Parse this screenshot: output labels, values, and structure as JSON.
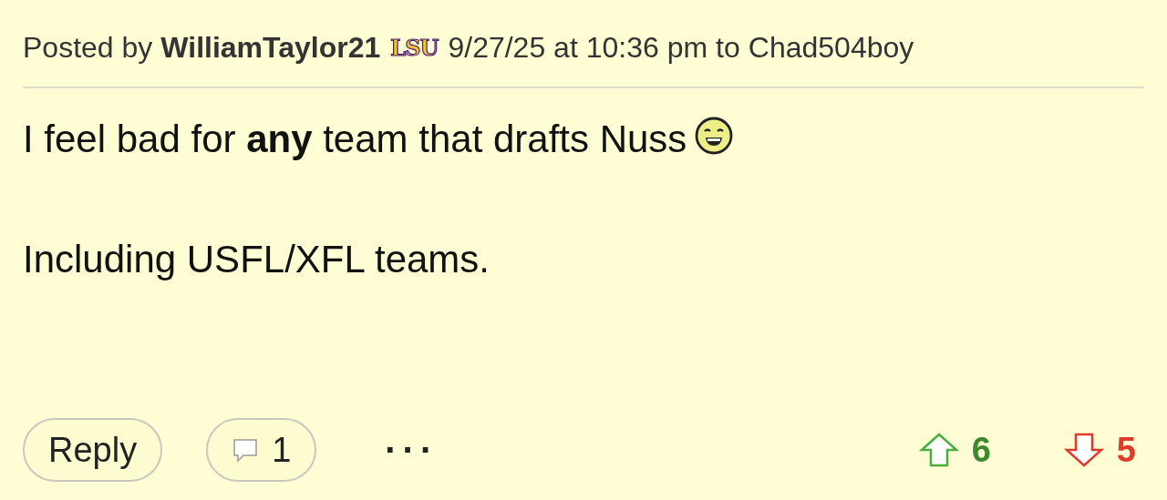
{
  "post": {
    "posted_by_label": "Posted by",
    "author": "WilliamTaylor21",
    "team_badge": "LSU",
    "timestamp": "9/27/25 at 10:36 pm",
    "to_label": "to",
    "reply_to": "Chad504boy"
  },
  "body": [
    {
      "text": "I feel bad for **any** team that drafts Nuss",
      "kind": "with_emoji"
    },
    {
      "text": "Including USFL/XFL teams.",
      "kind": "plain"
    }
  ],
  "actions": {
    "reply": "Reply",
    "comments": "1",
    "more": "···",
    "upvotes": "6",
    "downvotes": "5"
  }
}
